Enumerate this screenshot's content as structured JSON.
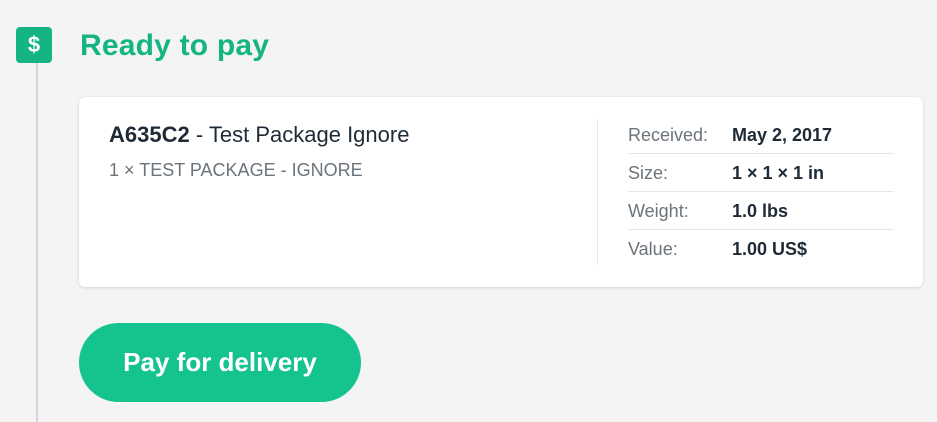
{
  "section": {
    "icon": "dollar-icon",
    "icon_glyph": "$",
    "title": "Ready to pay",
    "accent_color": "#14b582"
  },
  "package": {
    "code": "A635C2",
    "separator": " - ",
    "name": "Test Package Ignore",
    "contents": "1 × TEST PACKAGE - IGNORE"
  },
  "details": [
    {
      "label": "Received:",
      "value": "May 2, 2017"
    },
    {
      "label": "Size:",
      "value": "1 × 1 × 1 in"
    },
    {
      "label": "Weight:",
      "value": "1.0 lbs"
    },
    {
      "label": "Value:",
      "value": "1.00 US$"
    }
  ],
  "actions": {
    "pay_label": "Pay for delivery",
    "button_color": "#14c38e"
  }
}
